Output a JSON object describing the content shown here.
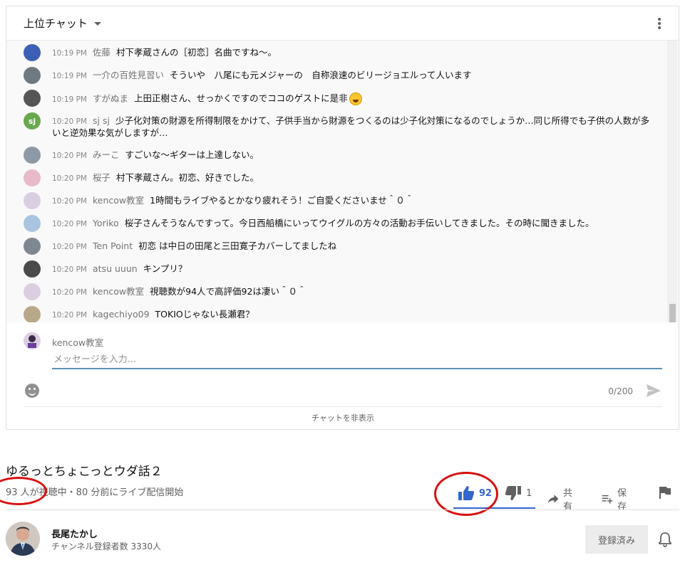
{
  "chat": {
    "mode_label": "上位チャット",
    "messages": [
      {
        "time": "10:19 PM",
        "author": "佐藤",
        "text": "村下孝蔵さんの［初恋］名曲ですね〜。",
        "avatar_color": "#3d5fb5",
        "avatar_letter": ""
      },
      {
        "time": "10:19 PM",
        "author": "一介の百姓見習い",
        "text": "そういや　八尾にも元メジャーの　自称浪速のビリージョエルって人います",
        "avatar_color": "#6f7a80",
        "avatar_letter": ""
      },
      {
        "time": "10:19 PM",
        "author": "すがぬま",
        "text": "上田正樹さん、せっかくですのでココのゲストに是非",
        "avatar_color": "#555555",
        "avatar_letter": "",
        "emoji": true
      },
      {
        "time": "10:20 PM",
        "author": "sj sj",
        "text": "少子化対策の財源を所得制限をかけて、子供手当から財源をつくるのは少子化対策になるのでしょうか…同じ所得でも子供の人数が多いと逆効果な気がしますが…",
        "avatar_color": "#6aa84f",
        "avatar_letter": "sj"
      },
      {
        "time": "10:20 PM",
        "author": "みーこ",
        "text": "すごいな〜ギターは上達しない。",
        "avatar_color": "#8d99a6",
        "avatar_letter": ""
      },
      {
        "time": "10:20 PM",
        "author": "桜子",
        "text": "村下孝蔵さん。初恋、好きでした。",
        "avatar_color": "#e8b9c8",
        "avatar_letter": ""
      },
      {
        "time": "10:20 PM",
        "author": "kencow教室",
        "text": "1時間もライブやるとかなり疲れそう！ご自愛くださいませ＾０＾",
        "avatar_color": "#d9cfe0",
        "avatar_letter": ""
      },
      {
        "time": "10:20 PM",
        "author": "Yoriko",
        "text": "桜子さんそうなんですって。今日西船橋にいってウイグルの方々の活動お手伝いしてきました。その時に聞きました。",
        "avatar_color": "#a9c4e0",
        "avatar_letter": ""
      },
      {
        "time": "10:20 PM",
        "author": "Ten Point",
        "text": "初恋 は中日の田尾と三田寛子カバーしてましたね",
        "avatar_color": "#7f8790",
        "avatar_letter": ""
      },
      {
        "time": "10:20 PM",
        "author": "atsu uuun",
        "text": "キンプリ？",
        "avatar_color": "#4a4a4a",
        "avatar_letter": ""
      },
      {
        "time": "10:20 PM",
        "author": "kencow教室",
        "text": "視聴数が94人で高評価92は凄い＾０＾",
        "avatar_color": "#d9cfe0",
        "avatar_letter": ""
      },
      {
        "time": "10:20 PM",
        "author": "kagechiyo09",
        "text": "TOKIOじゃない長瀬君？",
        "avatar_color": "#b8a88a",
        "avatar_letter": ""
      }
    ],
    "composer": {
      "author": "kencow教室",
      "placeholder": "メッセージを入力...",
      "char_count": "0/200"
    },
    "hide_label": "チャットを非表示"
  },
  "video": {
    "title": "ゆるっとちょこっとウダ話２",
    "view_info": "93 人が視聴中・80 分前にライブ配信開始",
    "likes": "92",
    "dislikes": "1",
    "share_label": "共有",
    "save_label": "保存"
  },
  "channel": {
    "name": "長尾たかし",
    "subscribers": "チャンネル登録者数 3330人",
    "subscribed_label": "登録済み"
  },
  "colors": {
    "accent_blue": "#3366cc",
    "annotation_red": "#d81010",
    "input_underline": "#5b8fb9"
  }
}
